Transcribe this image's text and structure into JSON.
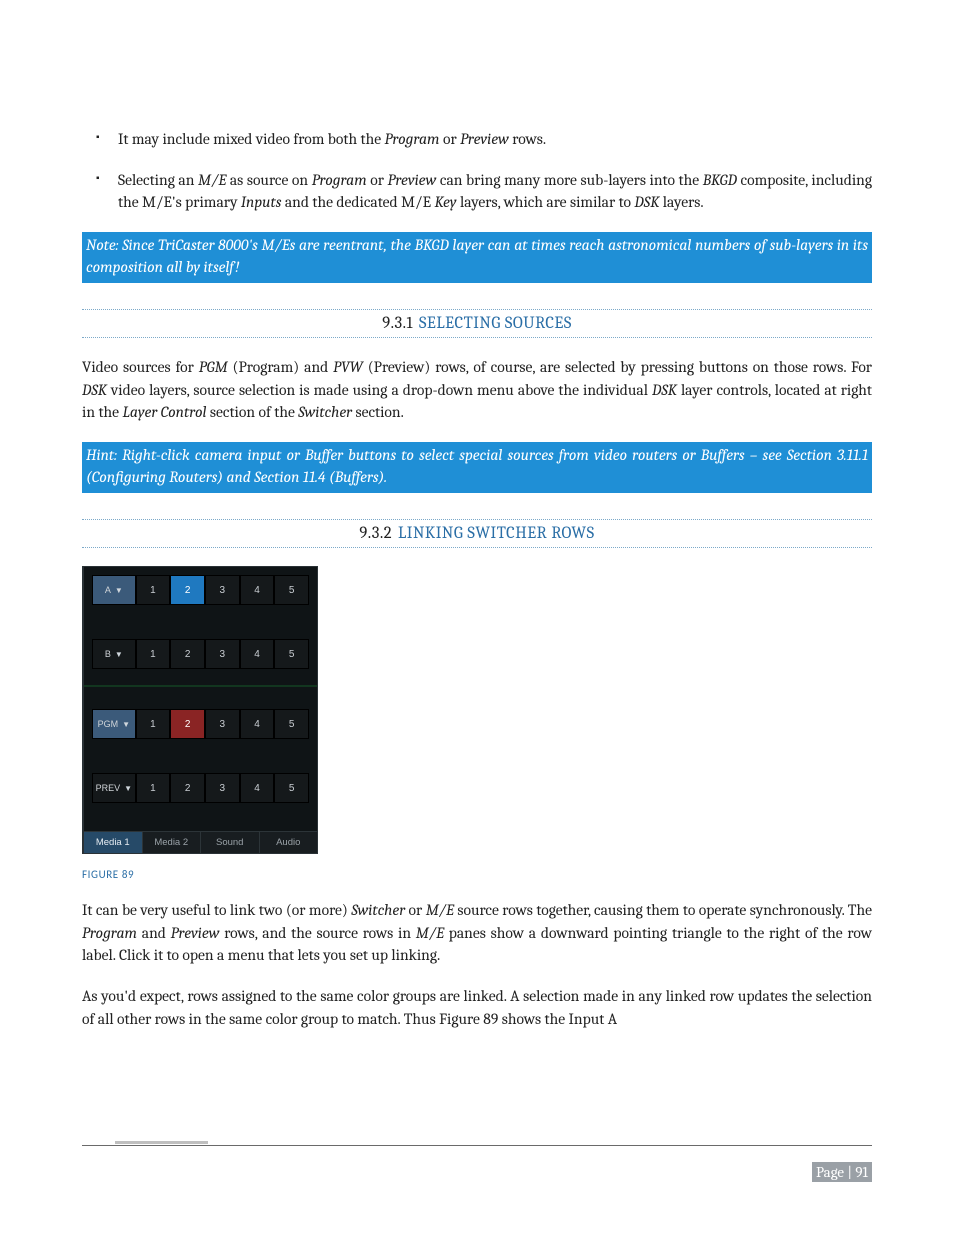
{
  "bullets": [
    {
      "pre": "It may include mixed video from both the ",
      "i1": "Program",
      "mid1": " or ",
      "i2": "Preview",
      "post": " rows."
    },
    {
      "pre": "Selecting an ",
      "i1": "M/E",
      "mid1": " as source on ",
      "i2": "Program",
      "mid2": " or ",
      "i3": "Preview",
      "mid3": " can bring many more sub-layers into the ",
      "i4": "BKGD",
      "mid4": " composite, including the M/E's primary ",
      "i5": "Inputs",
      "mid5": " and the dedicated M/E ",
      "i6": "Key",
      "mid6": " layers, which are similar to ",
      "i7": "DSK",
      "post": " layers."
    }
  ],
  "note1": "Note: Since TriCaster 8000's M/Es are reentrant, the BKGD layer can at times reach astronomical numbers of sub-layers in its composition all by itself!",
  "sec931": {
    "num": "9.3.1",
    "title": "SELECTING SOURCES"
  },
  "p1": {
    "t1": "Video sources for ",
    "i1": "PGM",
    "t2": " (Program) and ",
    "i2": "PVW",
    "t3": " (Preview) rows, of course, are selected by pressing buttons on those rows. For ",
    "i3": "DSK",
    "t4": " video layers, source selection is made using a drop-down menu above the individual ",
    "i4": "DSK",
    "t5": " layer controls, located at right in the ",
    "i5": "Layer Control",
    "t6": " section of the ",
    "i6": "Switcher",
    "t7": " section."
  },
  "hint1": "Hint: Right-click camera input or Buffer buttons to select special sources from video routers or Buffers – see Section 3.11.1 (Configuring Routers) and Section 11.4  (Buffers).",
  "sec932": {
    "num": "9.3.2",
    "title": "LINKING SWITCHER ROWS"
  },
  "switcher": {
    "rows": [
      {
        "label": "A",
        "style": "blue",
        "selected": 2,
        "selClass": "sel-blue"
      },
      {
        "label": "B",
        "style": "dark",
        "selected": 0,
        "selClass": ""
      },
      {
        "label": "PGM",
        "style": "blue",
        "selected": 2,
        "selClass": "sel-red"
      },
      {
        "label": "PREV",
        "style": "dark",
        "selected": 0,
        "selClass": ""
      }
    ],
    "cols": [
      "1",
      "2",
      "3",
      "4",
      "5"
    ],
    "tabs": [
      "Media 1",
      "Media 2",
      "Sound",
      "Audio"
    ],
    "activeTab": 0
  },
  "figcap": "FIGURE 89",
  "p2": {
    "t1": "It can be very useful to link two (or more) ",
    "i1": "Switcher",
    "t2": " or ",
    "i2": "M/E",
    "t3": " source rows together, causing them to operate synchronously.   The ",
    "i3": "Program",
    "t4": " and ",
    "i4": "Preview",
    "t5": " rows, and the source rows in ",
    "i5": "M/E",
    "t6": " panes show a downward pointing triangle to the right of the row label.  Click it to open a menu that lets you set up linking."
  },
  "p3": "As you'd expect, rows assigned to the same color groups are linked. A selection made in any linked row updates the selection of all other rows in the same color group to match. Thus Figure 89 shows the Input A",
  "footer": "Page | 91"
}
